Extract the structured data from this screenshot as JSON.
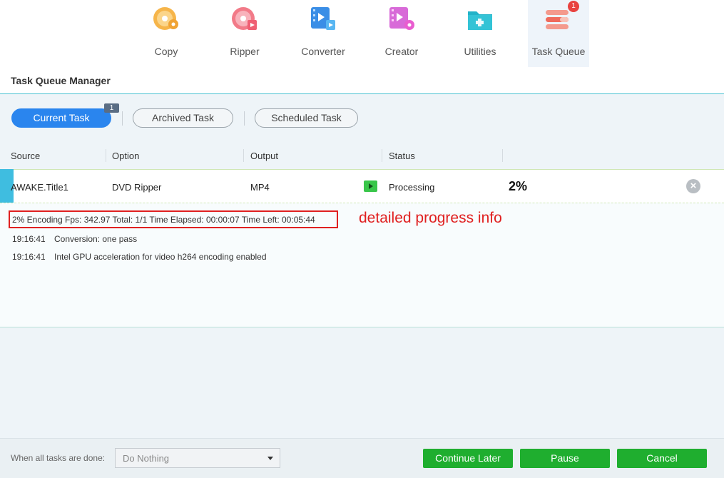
{
  "toolbar": {
    "items": [
      {
        "label": "Copy",
        "icon": "copy-disc-icon",
        "color": "#f0a334"
      },
      {
        "label": "Ripper",
        "icon": "ripper-disc-icon",
        "color": "#ef6a7a"
      },
      {
        "label": "Converter",
        "icon": "converter-film-icon",
        "color": "#3a8ee6"
      },
      {
        "label": "Creator",
        "icon": "creator-film-icon",
        "color": "#d65fd3"
      },
      {
        "label": "Utilities",
        "icon": "utilities-folder-icon",
        "color": "#22b3c9"
      },
      {
        "label": "Task Queue",
        "icon": "task-queue-icon",
        "color": "#ef6b5c",
        "badge": "1",
        "active": true
      }
    ]
  },
  "manager": {
    "title": "Task Queue Manager"
  },
  "tabs": {
    "current": "Current Task",
    "current_count": "1",
    "archived": "Archived Task",
    "scheduled": "Scheduled Task"
  },
  "columns": {
    "source": "Source",
    "option": "Option",
    "output": "Output",
    "status": "Status"
  },
  "task": {
    "source": "AWAKE.Title1",
    "option": "DVD Ripper",
    "output": "MP4",
    "status": "Processing",
    "percent": "2%"
  },
  "log": {
    "progress_line": "2%  Encoding Fps: 342.97   Total: 1/1  Time Elapsed: 00:00:07  Time Left: 00:05:44",
    "lines": [
      {
        "time": "19:16:41",
        "text": "Conversion: one pass"
      },
      {
        "time": "19:16:41",
        "text": "Intel GPU acceleration for video h264 encoding enabled"
      }
    ],
    "annotation": "detailed progress info"
  },
  "bottom": {
    "done_label": "When all tasks are done:",
    "done_value": "Do Nothing",
    "continue_later": "Continue Later",
    "pause": "Pause",
    "cancel": "Cancel"
  },
  "colors": {
    "accent_blue": "#2a85ee",
    "action_green": "#1fae2f",
    "annotation_red": "#e02020"
  }
}
